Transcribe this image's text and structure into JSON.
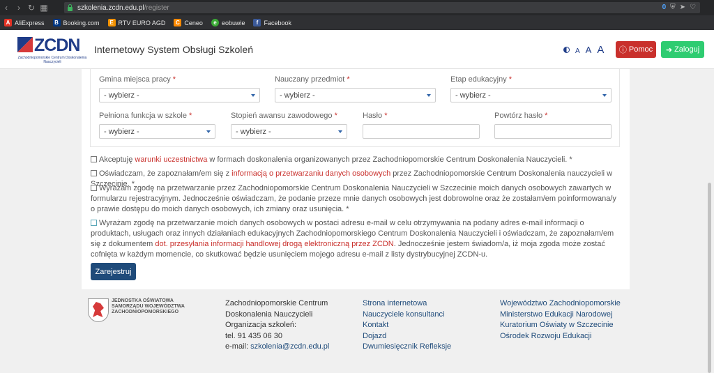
{
  "browser": {
    "url_domain": "szkolenia.zcdn.edu.pl",
    "url_path": "/register",
    "badge_count": "0"
  },
  "bookmarks": [
    {
      "label": "AliExpress",
      "icon": "aliexpress-icon",
      "color": "#e43225",
      "glyph": "A"
    },
    {
      "label": "Booking.com",
      "icon": "booking-icon",
      "color": "#003580",
      "glyph": "B"
    },
    {
      "label": "RTV EURO AGD",
      "icon": "rtv-euro-icon",
      "color": "#f39200",
      "glyph": "E"
    },
    {
      "label": "Ceneo",
      "icon": "ceneo-icon",
      "color": "#ff8a00",
      "glyph": "C"
    },
    {
      "label": "eobuwie",
      "icon": "eobuwie-icon",
      "color": "#3aa935",
      "glyph": "e"
    },
    {
      "label": "Facebook",
      "icon": "facebook-icon",
      "color": "#3b5998",
      "glyph": "f"
    }
  ],
  "header": {
    "logo": "ZCDN",
    "logo_sub": "Zachodniopomorskie Centrum Doskonalenia Nauczycieli",
    "title": "Internetowy System Obsługi Szkoleń",
    "font_a_small": "A",
    "font_a_medium": "A",
    "font_a_large": "A",
    "help_label": "Pomoc",
    "login_label": "Zaloguj"
  },
  "form": {
    "required_mark": "*",
    "gmina_label": "Gmina miejsca pracy",
    "gmina_value": "- wybierz -",
    "przedmiot_label": "Nauczany przedmiot",
    "przedmiot_value": "- wybierz -",
    "etap_label": "Etap edukacyjny",
    "etap_value": "- wybierz -",
    "funkcja_label": "Pełniona funkcja w szkole",
    "funkcja_value": "- wybierz -",
    "stopien_label": "Stopień awansu zawodowego",
    "stopien_value": "- wybierz -",
    "haslo_label": "Hasło",
    "powtorz_label": "Powtórz hasło"
  },
  "consents": {
    "c1_pre": "Akceptuję ",
    "c1_link": "warunki uczestnictwa",
    "c1_post": " w formach doskonalenia organizowanych przez Zachodniopomorskie Centrum Doskonalenia Nauczycieli. *",
    "c2_pre": "Oświadczam, że zapoznałam/em się z ",
    "c2_link": "informacją o przetwarzaniu danych osobowych",
    "c2_post": " przez Zachodniopomorskie Centrum Doskonalenia nauczycieli w Szczecinie. *",
    "c3_text": "Wyrażam zgodę na przetwarzanie przez Zachodniopomorskie Centrum Doskonalenia Nauczycieli w Szczecinie moich danych osobowych zawartych w formularzu rejestracyjnym. Jednocześnie oświadczam, że podanie przeze mnie danych osobowych jest dobrowolne oraz że zostałam/em poinformowana/y o prawie dostępu do moich danych osobowych, ich zmiany oraz usunięcia. *",
    "c4_pre": "Wyrażam zgodę na przetwarzanie moich danych osobowych w postaci adresu e-mail w celu otrzymywania na podany adres e-mail informacji o produktach, usługach oraz innych działaniach edukacyjnych Zachodniopomorskiego Centrum Doskonalenia Nauczycieli i oświadczam, że zapoznałam/em się z dokumentem ",
    "c4_link": "dot. przesyłania informacji handlowej drogą elektroniczną przez ZCDN",
    "c4_post": ". Jednocześnie jestem świadom/a, iż moja zgoda może zostać cofnięta w każdym momencie, co skutkować będzie usunięciem mojego adresu e-mail z listy dystrybucyjnej ZCDN-u.",
    "register_label": "Zarejestruj"
  },
  "footer": {
    "org_line1": "JEDNOSTKA OŚWIATOWA",
    "org_line2": "SAMORZĄDU WOJEWÓDZTWA",
    "org_line3": "ZACHODNIOPOMORSKIEGO",
    "address": [
      "Zachodniopomorskie Centrum",
      "Doskonalenia Nauczycieli",
      "Organizacja szkoleń:",
      "tel. 91 435 06 30"
    ],
    "email_label": "e-mail: ",
    "email": "szkolenia@zcdn.edu.pl",
    "links1": [
      "Strona internetowa",
      "Nauczyciele konsultanci",
      "Kontakt",
      "Dojazd",
      "Dwumiesięcznik Refleksje"
    ],
    "links2": [
      "Województwo Zachodniopomorskie",
      "Ministerstwo Edukacji Narodowej",
      "Kuratorium Oświaty w Szczecinie",
      "Ośrodek Rozwoju Edukacji"
    ]
  }
}
